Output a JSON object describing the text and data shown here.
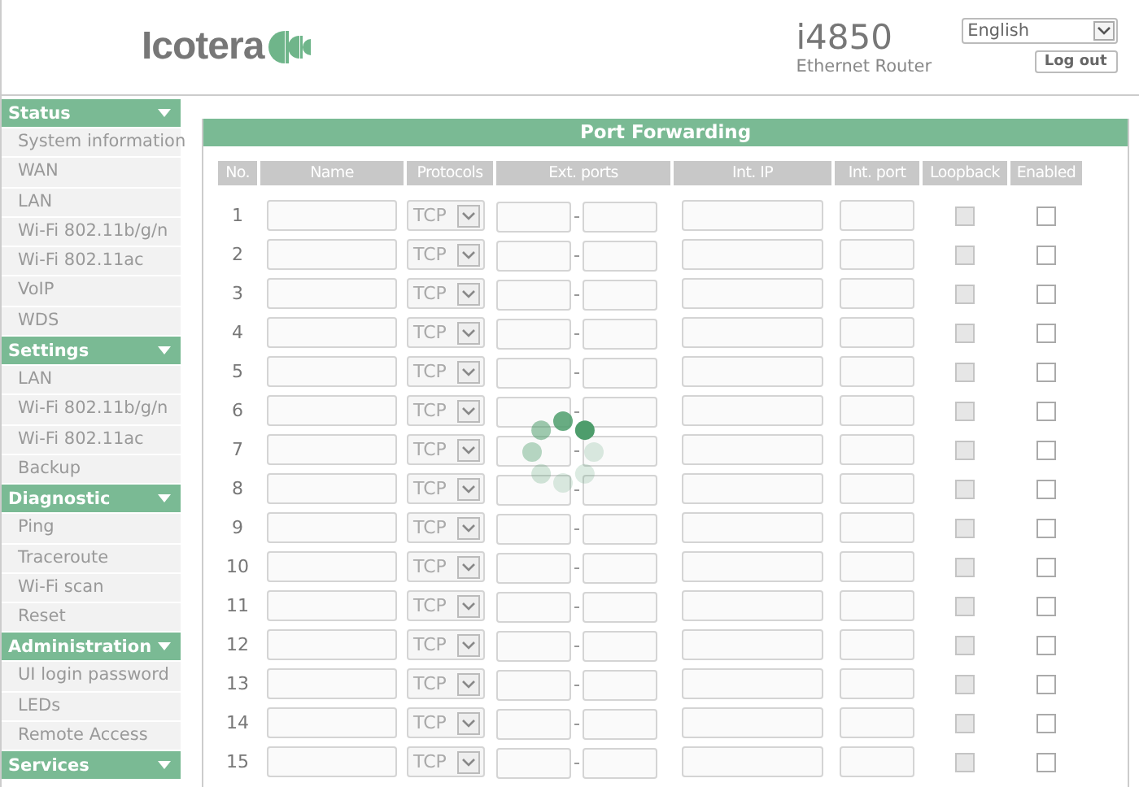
{
  "header": {
    "brand": "Icotera",
    "model": "i4850",
    "device_type": "Ethernet Router",
    "language": "English",
    "logout": "Log out"
  },
  "sidebar": [
    {
      "title": "Status",
      "expanded": true,
      "items": [
        "System information",
        "WAN",
        "LAN",
        "Wi-Fi 802.11b/g/n",
        "Wi-Fi 802.11ac",
        "VoIP",
        "WDS"
      ]
    },
    {
      "title": "Settings",
      "expanded": true,
      "items": [
        "LAN",
        "Wi-Fi 802.11b/g/n",
        "Wi-Fi 802.11ac",
        "Backup"
      ]
    },
    {
      "title": "Diagnostic",
      "expanded": true,
      "items": [
        "Ping",
        "Traceroute",
        "Wi-Fi scan",
        "Reset"
      ]
    },
    {
      "title": "Administration",
      "expanded": true,
      "items": [
        "UI login password",
        "LEDs",
        "Remote Access"
      ]
    },
    {
      "title": "Services",
      "expanded": true
    }
  ],
  "panel": {
    "title": "Port Forwarding",
    "loading": true,
    "columns": [
      "No.",
      "Name",
      "Protocols",
      "Ext. ports",
      "Int. IP",
      "Int. port",
      "Loopback",
      "Enabled"
    ],
    "rows": [
      {
        "no": "1",
        "protocol": "TCP",
        "loopback": {
          "checked": false,
          "disabled": true
        },
        "enabled": false
      },
      {
        "no": "2",
        "protocol": "TCP",
        "loopback": {
          "checked": false,
          "disabled": true
        },
        "enabled": false
      },
      {
        "no": "3",
        "protocol": "TCP",
        "loopback": {
          "checked": false,
          "disabled": true
        },
        "enabled": false
      },
      {
        "no": "4",
        "protocol": "TCP",
        "loopback": {
          "checked": false,
          "disabled": true
        },
        "enabled": false
      },
      {
        "no": "5",
        "protocol": "TCP",
        "loopback": {
          "checked": false,
          "disabled": true
        },
        "enabled": false
      },
      {
        "no": "6",
        "protocol": "TCP",
        "loopback": {
          "checked": false,
          "disabled": true
        },
        "enabled": false
      },
      {
        "no": "7",
        "protocol": "TCP",
        "loopback": {
          "checked": false,
          "disabled": true
        },
        "enabled": false
      },
      {
        "no": "8",
        "protocol": "TCP",
        "loopback": {
          "checked": false,
          "disabled": true
        },
        "enabled": false
      },
      {
        "no": "9",
        "protocol": "TCP",
        "loopback": {
          "checked": false,
          "disabled": true
        },
        "enabled": false
      },
      {
        "no": "10",
        "protocol": "TCP",
        "loopback": {
          "checked": false,
          "disabled": true
        },
        "enabled": false
      },
      {
        "no": "11",
        "protocol": "TCP",
        "loopback": {
          "checked": false,
          "disabled": true
        },
        "enabled": false
      },
      {
        "no": "12",
        "protocol": "TCP",
        "loopback": {
          "checked": false,
          "disabled": true
        },
        "enabled": false
      },
      {
        "no": "13",
        "protocol": "TCP",
        "loopback": {
          "checked": false,
          "disabled": true
        },
        "enabled": false
      },
      {
        "no": "14",
        "protocol": "TCP",
        "loopback": {
          "checked": false,
          "disabled": true
        },
        "enabled": false
      },
      {
        "no": "15",
        "protocol": "TCP",
        "loopback": {
          "checked": false,
          "disabled": true
        },
        "enabled": false
      }
    ]
  }
}
